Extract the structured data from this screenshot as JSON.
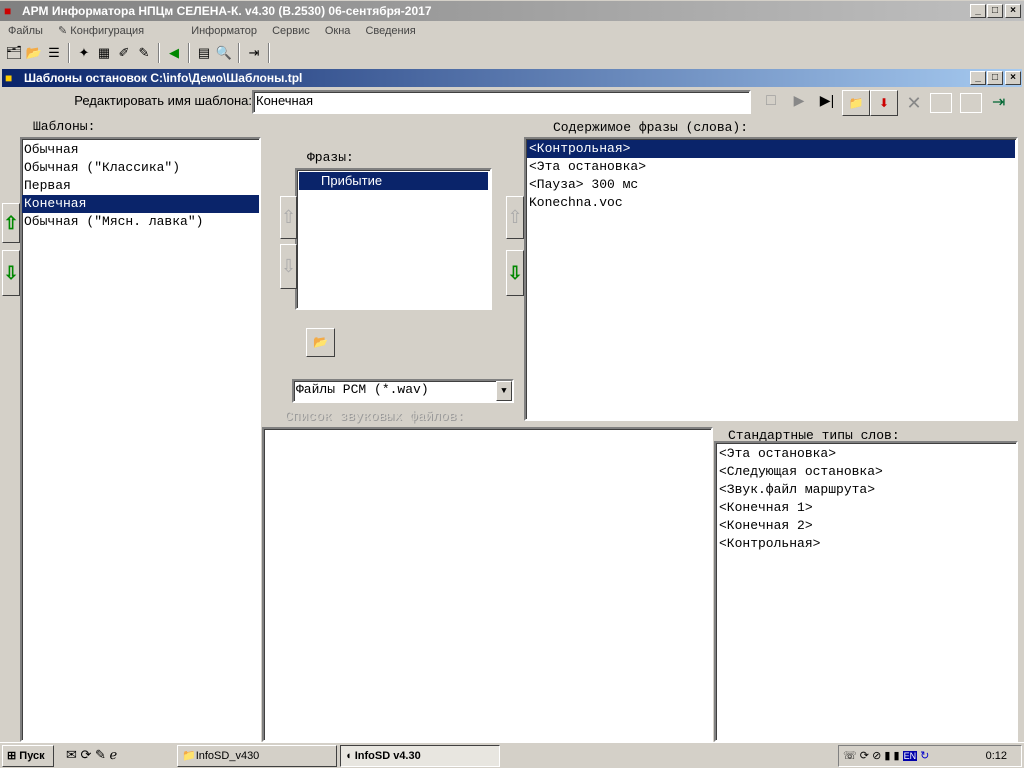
{
  "app": {
    "title": "АРМ Информатора НПЦм СЕЛЕНА-К. v4.30 (B.2530) 06-сентября-2017"
  },
  "menu": [
    "Файлы",
    "Конфигурация",
    "Информатор",
    "Сервис",
    "Окна",
    "Сведения"
  ],
  "child": {
    "title": "Шаблоны остановок C:\\info\\Демо\\Шаблоны.tpl"
  },
  "edit": {
    "label": "Редактировать имя шаблона:",
    "value": "Конечная"
  },
  "templates": {
    "label": "Шаблоны:",
    "items": [
      "Обычная",
      "Обычная (\"Классика\")",
      "Первая",
      "Конечная",
      "Обычная (\"Мясн. лавка\")"
    ],
    "selected": 3
  },
  "phrases": {
    "label": "Фразы:",
    "items": [
      "Прибытие"
    ]
  },
  "filter": {
    "value": "Файлы PCM (*.wav)"
  },
  "sound_files": {
    "label": "Список звуковых файлов:"
  },
  "content": {
    "label": "Содержимое фразы (слова):",
    "items": [
      "<Контрольная>",
      "<Эта остановка>",
      "<Пауза> 300 мс",
      "Konechna.voc"
    ]
  },
  "std_words": {
    "label": "Стандартные типы слов:",
    "items": [
      "<Эта остановка>",
      "<Следующая остановка>",
      "<Звук.файл маршрута>",
      "<Конечная 1>",
      "<Конечная 2>",
      "<Контрольная>"
    ]
  },
  "taskbar": {
    "start": "Пуск",
    "tasks": [
      "InfoSD_v430",
      "InfoSD v4.30"
    ],
    "tray_lang": "EN",
    "clock": "0:12"
  }
}
